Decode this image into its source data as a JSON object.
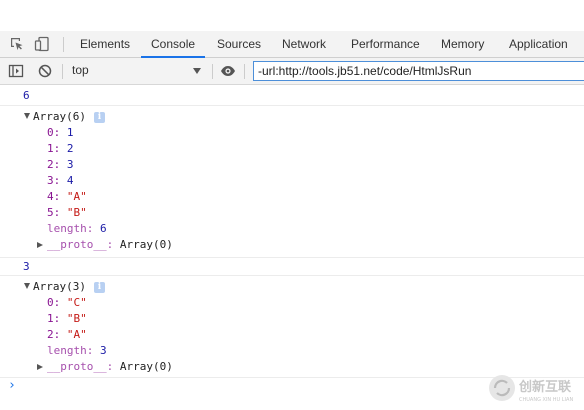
{
  "tabs": [
    "Elements",
    "Console",
    "Sources",
    "Network",
    "Performance",
    "Memory",
    "Application"
  ],
  "toolbar": {
    "context": "top",
    "filter_value": "-url:http://tools.jb51.net/code/HtmlJsRun"
  },
  "console": {
    "first_value": "6",
    "array1": {
      "summary": "Array(6)",
      "items": [
        {
          "k": "0:",
          "v": "1",
          "t": "num"
        },
        {
          "k": "1:",
          "v": "2",
          "t": "num"
        },
        {
          "k": "2:",
          "v": "3",
          "t": "num"
        },
        {
          "k": "3:",
          "v": "4",
          "t": "num"
        },
        {
          "k": "4:",
          "v": "\"A\"",
          "t": "str"
        },
        {
          "k": "5:",
          "v": "\"B\"",
          "t": "str"
        }
      ],
      "length_key": "length:",
      "length_val": "6",
      "proto_key": "__proto__:",
      "proto_val": "Array(0)"
    },
    "second_value": "3",
    "array2": {
      "summary": "Array(3)",
      "items": [
        {
          "k": "0:",
          "v": "\"C\"",
          "t": "str"
        },
        {
          "k": "1:",
          "v": "\"B\"",
          "t": "str"
        },
        {
          "k": "2:",
          "v": "\"A\"",
          "t": "str"
        }
      ],
      "length_key": "length:",
      "length_val": "3",
      "proto_key": "__proto__:",
      "proto_val": "Array(0)"
    },
    "prompt": "›"
  },
  "watermark": {
    "brand": "创新互联",
    "sub": "CHUANG XIN HU LIAN"
  },
  "colors": {
    "accent": "#1a73e8",
    "number": "#1a1aa6",
    "string": "#c41a16",
    "key": "#881391"
  },
  "icons": [
    "inspect-icon",
    "device-toolbar-icon",
    "sidebar-toggle-icon",
    "clear-console-icon",
    "eye-icon",
    "info-icon"
  ]
}
